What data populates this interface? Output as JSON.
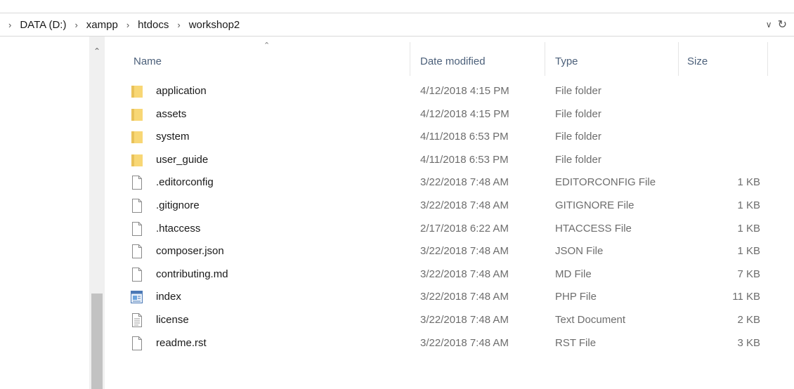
{
  "address": {
    "crumbs": [
      "DATA (D:)",
      "xampp",
      "htdocs",
      "workshop2"
    ]
  },
  "columns": {
    "name": "Name",
    "date": "Date modified",
    "type": "Type",
    "size": "Size"
  },
  "files": [
    {
      "name": "application",
      "date": "4/12/2018 4:15 PM",
      "type": "File folder",
      "size": "",
      "icon": "folder-icon"
    },
    {
      "name": "assets",
      "date": "4/12/2018 4:15 PM",
      "type": "File folder",
      "size": "",
      "icon": "folder-icon"
    },
    {
      "name": "system",
      "date": "4/11/2018 6:53 PM",
      "type": "File folder",
      "size": "",
      "icon": "folder-icon"
    },
    {
      "name": "user_guide",
      "date": "4/11/2018 6:53 PM",
      "type": "File folder",
      "size": "",
      "icon": "folder-icon"
    },
    {
      "name": ".editorconfig",
      "date": "3/22/2018 7:48 AM",
      "type": "EDITORCONFIG File",
      "size": "1 KB",
      "icon": "file-icon"
    },
    {
      "name": ".gitignore",
      "date": "3/22/2018 7:48 AM",
      "type": "GITIGNORE File",
      "size": "1 KB",
      "icon": "file-icon"
    },
    {
      "name": ".htaccess",
      "date": "2/17/2018 6:22 AM",
      "type": "HTACCESS File",
      "size": "1 KB",
      "icon": "file-icon"
    },
    {
      "name": "composer.json",
      "date": "3/22/2018 7:48 AM",
      "type": "JSON File",
      "size": "1 KB",
      "icon": "file-icon"
    },
    {
      "name": "contributing.md",
      "date": "3/22/2018 7:48 AM",
      "type": "MD File",
      "size": "7 KB",
      "icon": "file-icon"
    },
    {
      "name": "index",
      "date": "3/22/2018 7:48 AM",
      "type": "PHP File",
      "size": "11 KB",
      "icon": "php-file-icon"
    },
    {
      "name": "license",
      "date": "3/22/2018 7:48 AM",
      "type": "Text Document",
      "size": "2 KB",
      "icon": "text-document-icon"
    },
    {
      "name": "readme.rst",
      "date": "3/22/2018 7:48 AM",
      "type": "RST File",
      "size": "3 KB",
      "icon": "file-icon"
    }
  ],
  "colors": {
    "folder": "#f8d775",
    "header_text": "#4c607a",
    "secondary_text": "#6d6d6d"
  }
}
